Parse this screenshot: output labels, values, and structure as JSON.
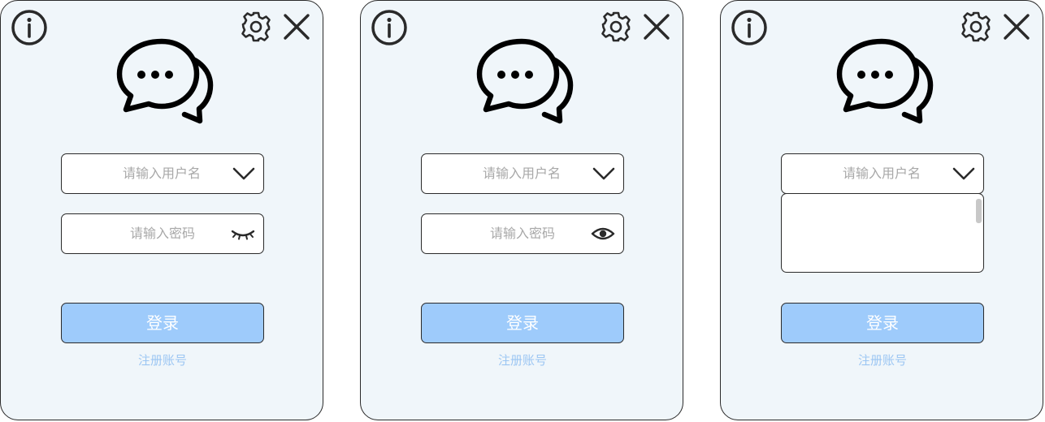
{
  "panels": [
    {
      "username_placeholder": "请输入用户名",
      "password_placeholder": "请输入密码",
      "login_label": "登录",
      "register_label": "注册账号",
      "password_visibility": "hidden"
    },
    {
      "username_placeholder": "请输入用户名",
      "password_placeholder": "请输入密码",
      "login_label": "登录",
      "register_label": "注册账号",
      "password_visibility": "visible"
    },
    {
      "username_placeholder": "请输入用户名",
      "login_label": "登录",
      "register_label": "注册账号",
      "username_dropdown_open": true
    }
  ],
  "icons": {
    "info": "info-icon",
    "settings": "gear-icon",
    "close": "close-icon",
    "logo": "chat-bubbles-icon",
    "dropdown": "chevron-down-icon",
    "password_hidden": "eye-closed-icon",
    "password_visible": "eye-open-icon"
  },
  "colors": {
    "panel_background": "#f0f6fa",
    "login_button": "#9ecbfb",
    "register_link": "#9cc6f3",
    "placeholder": "#a8a8a8",
    "icon_stroke": "#2a2a2a"
  }
}
